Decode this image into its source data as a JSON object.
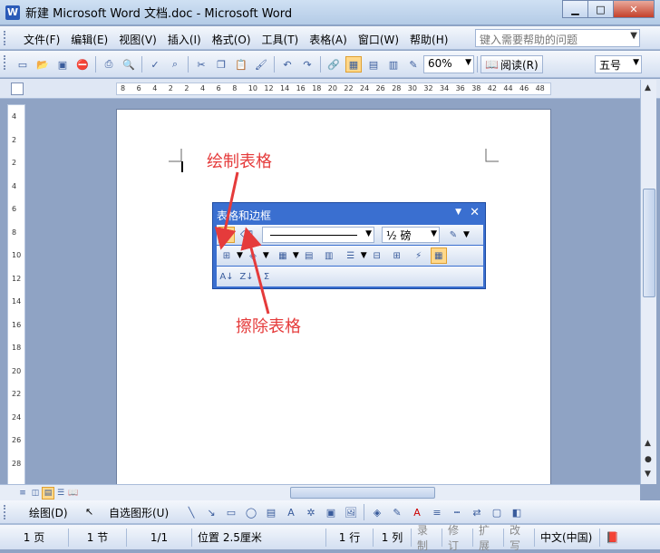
{
  "window": {
    "app_icon": "W",
    "title": "新建 Microsoft Word 文档.doc - Microsoft Word"
  },
  "menu": {
    "items": [
      "文件(F)",
      "编辑(E)",
      "视图(V)",
      "插入(I)",
      "格式(O)",
      "工具(T)",
      "表格(A)",
      "窗口(W)",
      "帮助(H)"
    ],
    "help_placeholder": "键入需要帮助的问题"
  },
  "toolbar": {
    "zoom": "60%",
    "read_label": "阅读(R)",
    "font_size": "五号"
  },
  "ruler": {
    "h_ticks": [
      "8",
      "6",
      "4",
      "2",
      "2",
      "4",
      "6",
      "8",
      "10",
      "12",
      "14",
      "16",
      "18",
      "20",
      "22",
      "24",
      "26",
      "28",
      "30",
      "32",
      "34",
      "36",
      "38",
      "42",
      "44",
      "46",
      "48"
    ],
    "v_ticks": [
      "4",
      "2",
      "2",
      "4",
      "6",
      "8",
      "10",
      "12",
      "14",
      "16",
      "18",
      "20",
      "22",
      "24",
      "26",
      "28"
    ]
  },
  "palette": {
    "title": "表格和边框",
    "line_weight": "½ 磅"
  },
  "annotations": {
    "draw_table": "绘制表格",
    "erase_table": "擦除表格"
  },
  "drawbar": {
    "draw_label": "绘图(D)",
    "autoshape_label": "自选图形(U)"
  },
  "status": {
    "page": "1 页",
    "section": "1 节",
    "page_of": "1/1",
    "position": "位置 2.5厘米",
    "line": "1 行",
    "column": "1 列",
    "rec": "录制",
    "trk": "修订",
    "ext": "扩展",
    "ovr": "改写",
    "language": "中文(中国)"
  },
  "colors": {
    "accent": "#3a6fd0",
    "annotation": "#e53b3b",
    "background": "#8fa3c4"
  }
}
